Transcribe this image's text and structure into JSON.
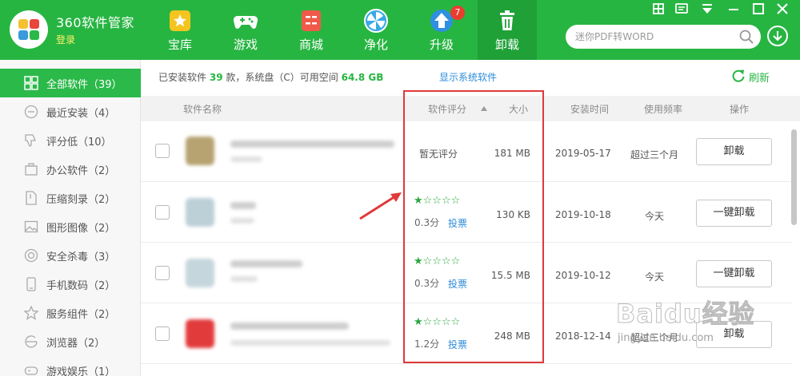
{
  "header": {
    "app_title": "360软件管家",
    "login": "登录",
    "nav": [
      {
        "label": "宝库",
        "icon": "treasure-icon"
      },
      {
        "label": "游戏",
        "icon": "gamepad-icon"
      },
      {
        "label": "商城",
        "icon": "store-icon"
      },
      {
        "label": "净化",
        "icon": "purify-icon"
      },
      {
        "label": "升级",
        "icon": "upgrade-icon",
        "badge": "7"
      },
      {
        "label": "卸载",
        "icon": "trash-icon",
        "active": true
      }
    ],
    "search_placeholder": "迷你PDF转WORD",
    "accent": "#27b542"
  },
  "sidebar": {
    "items": [
      {
        "label": "全部软件（39）",
        "icon": "grid-icon",
        "active": true
      },
      {
        "label": "最近安装（4）",
        "icon": "recent-icon"
      },
      {
        "label": "评分低（10）",
        "icon": "thumb-down-icon"
      },
      {
        "label": "办公软件（2）",
        "icon": "briefcase-icon"
      },
      {
        "label": "压缩刻录（2）",
        "icon": "archive-icon"
      },
      {
        "label": "图形图像（2）",
        "icon": "image-icon"
      },
      {
        "label": "安全杀毒（3）",
        "icon": "shield-icon"
      },
      {
        "label": "手机数码（2）",
        "icon": "phone-icon"
      },
      {
        "label": "服务组件（2）",
        "icon": "star-icon"
      },
      {
        "label": "浏览器（2）",
        "icon": "browser-icon"
      },
      {
        "label": "游戏娱乐（1）",
        "icon": "game-icon"
      }
    ]
  },
  "info": {
    "prefix": "已安装软件",
    "count": "39",
    "middle": "款，系统盘（C）可用空间",
    "space": "64.8 GB",
    "show_system": "显示系统软件",
    "refresh": "刷新"
  },
  "table": {
    "headers": {
      "name": "软件名称",
      "rating": "软件评分",
      "size": "大小",
      "install_date": "安装时间",
      "frequency": "使用频率",
      "action": "操作"
    },
    "rows": [
      {
        "rating_text": "暂无评分",
        "size": "181 MB",
        "date": "2019-05-17",
        "freq": "超过三个月",
        "action": "卸载",
        "thumb_color": "#b7a371"
      },
      {
        "stars": "★☆☆☆☆",
        "score": "0.3分",
        "vote": "投票",
        "size": "130 KB",
        "date": "2019-10-18",
        "freq": "今天",
        "action": "一键卸载",
        "thumb_color": "#bcd0d8"
      },
      {
        "stars": "★☆☆☆☆",
        "score": "0.3分",
        "vote": "投票",
        "size": "15.5 MB",
        "date": "2019-10-12",
        "freq": "今天",
        "action": "一键卸载",
        "thumb_color": "#c5d6dc"
      },
      {
        "stars": "★☆☆☆☆",
        "score": "1.2分",
        "vote": "投票",
        "size": "248 MB",
        "date": "2018-12-14",
        "freq": "超过三个月",
        "action": "卸载",
        "thumb_color": "#e23b3b"
      }
    ]
  },
  "watermark": {
    "main": "Baidu经验",
    "sub": "jingyan.baidu.com"
  }
}
